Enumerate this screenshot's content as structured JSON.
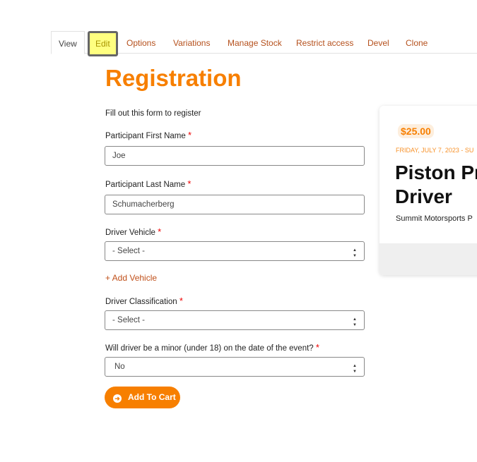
{
  "tabs": [
    {
      "label": "View"
    },
    {
      "label": "Edit"
    },
    {
      "label": "Options"
    },
    {
      "label": "Variations"
    },
    {
      "label": "Manage Stock"
    },
    {
      "label": "Restrict access"
    },
    {
      "label": "Devel"
    },
    {
      "label": "Clone"
    }
  ],
  "title": "Registration",
  "form": {
    "intro": "Fill out this form to register",
    "required_mark": "*",
    "first_name": {
      "label": "Participant First Name",
      "value": "Joe"
    },
    "last_name": {
      "label": "Participant Last Name",
      "value": "Schumacherberg"
    },
    "vehicle": {
      "label": "Driver Vehicle",
      "value": "- Select -"
    },
    "add_vehicle": "+ Add Vehicle",
    "classification": {
      "label": "Driver Classification",
      "value": "- Select -"
    },
    "minor": {
      "label": "Will driver be a minor (under 18) on the date of the event?",
      "value": "No"
    },
    "submit": "Add To Cart"
  },
  "card": {
    "price": "$25.00",
    "date": "FRIDAY, JULY 7, 2023 - SU",
    "title_line1": "Piston Pr",
    "title_line2": "Driver",
    "venue": "Summit Motorsports P"
  },
  "colors": {
    "accent": "#f77f00",
    "link": "#b5501c",
    "highlight": "#ffff80"
  }
}
